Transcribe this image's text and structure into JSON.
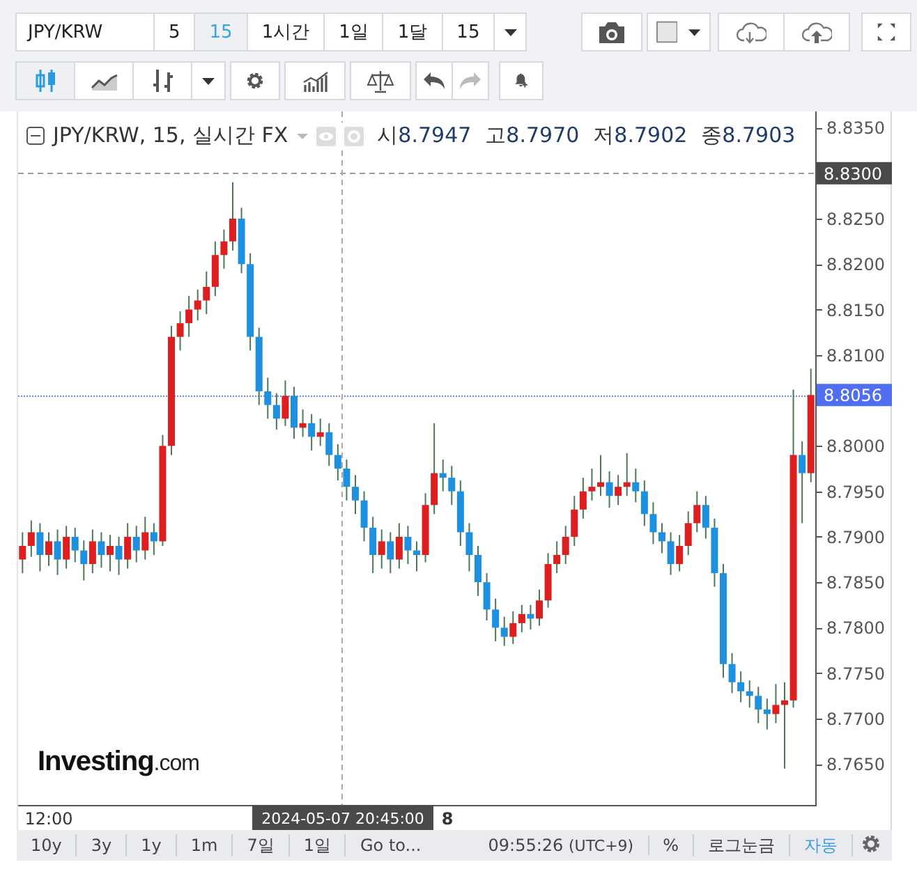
{
  "toolbar": {
    "symbol": "JPY/KRW",
    "intervals": [
      {
        "label": "5",
        "selected": false
      },
      {
        "label": "15",
        "selected": true
      },
      {
        "label": "1시간",
        "selected": false
      },
      {
        "label": "1일",
        "selected": false
      },
      {
        "label": "1달",
        "selected": false
      }
    ],
    "interval_dropdown": "15",
    "chart_types": [
      {
        "kind": "candle",
        "selected": true
      },
      {
        "kind": "area",
        "selected": false
      },
      {
        "kind": "bar",
        "selected": false
      }
    ]
  },
  "legend": {
    "title": "JPY/KRW, 15, 실시간 FX",
    "values": [
      {
        "label": "시",
        "value": "8.7947"
      },
      {
        "label": "고",
        "value": "8.7970"
      },
      {
        "label": "저",
        "value": "8.7902"
      },
      {
        "label": "종",
        "value": "8.7903"
      }
    ]
  },
  "chart": {
    "chart_data": {
      "type": "candlestick",
      "ylim": [
        8.7605,
        8.8368
      ],
      "ref_lines": [
        {
          "axis": "y",
          "value": 8.83,
          "label": "8.8300",
          "color": "#4a4a4a"
        },
        {
          "axis": "y",
          "value": 8.8056,
          "label": "8.8056",
          "color": "#4f6ff0"
        }
      ],
      "yticks": [
        {
          "value": 8.835,
          "label": "8.8350"
        },
        {
          "value": 8.825,
          "label": "8.8250"
        },
        {
          "value": 8.82,
          "label": "8.8200"
        },
        {
          "value": 8.815,
          "label": "8.8150"
        },
        {
          "value": 8.81,
          "label": "8.8100"
        },
        {
          "value": 8.8,
          "label": "8.8000"
        },
        {
          "value": 8.795,
          "label": "8.7950"
        },
        {
          "value": 8.79,
          "label": "8.7900"
        },
        {
          "value": 8.785,
          "label": "8.7850"
        },
        {
          "value": 8.78,
          "label": "8.7800"
        },
        {
          "value": 8.775,
          "label": "8.7750"
        },
        {
          "value": 8.77,
          "label": "8.7700"
        },
        {
          "value": 8.765,
          "label": "8.7650"
        }
      ],
      "categories": [
        null,
        null,
        null,
        null,
        null,
        null,
        null,
        null,
        null,
        null,
        null,
        null,
        null,
        null,
        null,
        null,
        null,
        null,
        null,
        null,
        null,
        null,
        null,
        null,
        null,
        null,
        null,
        null,
        null,
        null,
        null,
        null,
        null,
        null,
        null,
        null,
        null,
        null,
        null,
        null,
        null,
        null,
        null,
        null,
        null,
        null,
        null,
        null,
        null,
        null,
        null,
        null,
        null,
        null,
        null,
        null,
        null,
        null,
        null,
        null,
        null,
        null,
        null,
        null,
        null,
        null,
        null,
        null,
        null,
        null,
        null,
        null,
        null,
        null,
        null,
        null,
        null,
        null,
        null,
        null,
        null,
        null,
        null,
        null,
        null,
        null,
        null,
        null,
        null,
        null,
        null
      ],
      "ohlc": [
        [
          8.7875,
          8.7905,
          8.786,
          8.789
        ],
        [
          8.789,
          8.7918,
          8.7878,
          8.7905
        ],
        [
          8.7905,
          8.7915,
          8.7862,
          8.788
        ],
        [
          8.788,
          8.7905,
          8.7868,
          8.7895
        ],
        [
          8.7895,
          8.7908,
          8.7858,
          8.7875
        ],
        [
          8.7875,
          8.7912,
          8.7865,
          8.79
        ],
        [
          8.79,
          8.791,
          8.7872,
          8.7885
        ],
        [
          8.7885,
          8.7896,
          8.7852,
          8.787
        ],
        [
          8.787,
          8.7908,
          8.786,
          8.7895
        ],
        [
          8.7895,
          8.7905,
          8.7866,
          8.788
        ],
        [
          8.788,
          8.7902,
          8.7862,
          8.789
        ],
        [
          8.789,
          8.79,
          8.7858,
          8.7875
        ],
        [
          8.7875,
          8.7915,
          8.7865,
          8.79
        ],
        [
          8.79,
          8.7912,
          8.7872,
          8.7885
        ],
        [
          8.7885,
          8.7922,
          8.7875,
          8.7905
        ],
        [
          8.7905,
          8.7915,
          8.788,
          8.7895
        ],
        [
          8.7895,
          8.8012,
          8.789,
          8.8
        ],
        [
          8.8,
          8.8132,
          8.799,
          8.812
        ],
        [
          8.812,
          8.8148,
          8.8105,
          8.8135
        ],
        [
          8.8135,
          8.8165,
          8.812,
          8.815
        ],
        [
          8.815,
          8.8172,
          8.8138,
          8.816
        ],
        [
          8.816,
          8.8192,
          8.8145,
          8.8175
        ],
        [
          8.8175,
          8.8225,
          8.8165,
          8.821
        ],
        [
          8.821,
          8.8238,
          8.8195,
          8.8225
        ],
        [
          8.8225,
          8.829,
          8.8215,
          8.825
        ],
        [
          8.825,
          8.8262,
          8.819,
          8.82
        ],
        [
          8.82,
          8.8212,
          8.8105,
          8.812
        ],
        [
          8.812,
          8.813,
          8.8045,
          8.806
        ],
        [
          8.806,
          8.8075,
          8.803,
          8.8045
        ],
        [
          8.8045,
          8.8058,
          8.8018,
          8.803
        ],
        [
          8.803,
          8.8072,
          8.8022,
          8.8055
        ],
        [
          8.8055,
          8.8065,
          8.8008,
          8.802
        ],
        [
          8.802,
          8.804,
          8.801,
          8.8025
        ],
        [
          8.8025,
          8.8035,
          8.7995,
          8.801
        ],
        [
          8.801,
          8.803,
          8.8,
          8.8015
        ],
        [
          8.8015,
          8.8025,
          8.7978,
          8.799
        ],
        [
          8.799,
          8.8002,
          8.7962,
          8.7975
        ],
        [
          8.7975,
          8.7985,
          8.794,
          8.7955
        ],
        [
          8.7955,
          8.7968,
          8.7925,
          8.794
        ],
        [
          8.794,
          8.795,
          8.7895,
          8.791
        ],
        [
          8.791,
          8.7922,
          8.786,
          8.788
        ],
        [
          8.788,
          8.7908,
          8.7865,
          8.7895
        ],
        [
          8.7895,
          8.7905,
          8.786,
          8.7875
        ],
        [
          8.7875,
          8.7915,
          8.7865,
          8.79
        ],
        [
          8.79,
          8.7912,
          8.787,
          8.7885
        ],
        [
          8.7885,
          8.7895,
          8.7862,
          8.788
        ],
        [
          8.788,
          8.7948,
          8.7872,
          8.7935
        ],
        [
          8.7935,
          8.8025,
          8.7925,
          8.797
        ],
        [
          8.797,
          8.7985,
          8.795,
          8.7965
        ],
        [
          8.7965,
          8.7978,
          8.7935,
          8.795
        ],
        [
          8.795,
          8.7962,
          8.789,
          8.7905
        ],
        [
          8.7905,
          8.7915,
          8.7862,
          8.788
        ],
        [
          8.788,
          8.789,
          8.7835,
          8.785
        ],
        [
          8.785,
          8.786,
          8.7808,
          8.782
        ],
        [
          8.782,
          8.7832,
          8.7785,
          8.78
        ],
        [
          8.78,
          8.7812,
          8.778,
          8.779
        ],
        [
          8.779,
          8.7818,
          8.7782,
          8.7805
        ],
        [
          8.7805,
          8.7825,
          8.7795,
          8.7815
        ],
        [
          8.7815,
          8.7825,
          8.7798,
          8.781
        ],
        [
          8.781,
          8.7842,
          8.7802,
          8.783
        ],
        [
          8.783,
          8.7882,
          8.7822,
          8.787
        ],
        [
          8.787,
          8.7895,
          8.786,
          8.788
        ],
        [
          8.788,
          8.7912,
          8.787,
          8.79
        ],
        [
          8.79,
          8.7945,
          8.789,
          8.793
        ],
        [
          8.793,
          8.7965,
          8.792,
          8.795
        ],
        [
          8.795,
          8.7975,
          8.794,
          8.7955
        ],
        [
          8.7955,
          8.799,
          8.7945,
          8.796
        ],
        [
          8.796,
          8.7972,
          8.7932,
          8.7945
        ],
        [
          8.7945,
          8.7968,
          8.7935,
          8.7955
        ],
        [
          8.7955,
          8.7992,
          8.7945,
          8.796
        ],
        [
          8.796,
          8.7975,
          8.7938,
          8.795
        ],
        [
          8.795,
          8.7962,
          8.7912,
          8.7925
        ],
        [
          8.7925,
          8.7938,
          8.7892,
          8.7905
        ],
        [
          8.7905,
          8.7915,
          8.7882,
          8.7895
        ],
        [
          8.7895,
          8.7905,
          8.7858,
          8.787
        ],
        [
          8.787,
          8.7902,
          8.7862,
          8.789
        ],
        [
          8.789,
          8.7928,
          8.788,
          8.7915
        ],
        [
          8.7915,
          8.795,
          8.7905,
          8.7935
        ],
        [
          8.7935,
          8.7945,
          8.7898,
          8.791
        ],
        [
          8.791,
          8.792,
          8.7845,
          8.786
        ],
        [
          8.786,
          8.787,
          8.7745,
          8.776
        ],
        [
          8.776,
          8.7772,
          8.7728,
          8.774
        ],
        [
          8.774,
          8.7752,
          8.7718,
          8.773
        ],
        [
          8.773,
          8.7742,
          8.7712,
          8.7725
        ],
        [
          8.7725,
          8.7735,
          8.7695,
          8.771
        ],
        [
          8.771,
          8.7722,
          8.7688,
          8.7705
        ],
        [
          8.7705,
          8.7738,
          8.7695,
          8.7715
        ],
        [
          8.7715,
          8.774,
          8.7645,
          8.772
        ],
        [
          8.772,
          8.8062,
          8.7712,
          8.799
        ],
        [
          8.799,
          8.8005,
          8.7915,
          8.797
        ],
        [
          8.797,
          8.8085,
          8.796,
          8.8056
        ]
      ]
    }
  },
  "time_axis": {
    "labels": [
      {
        "text": "12:00",
        "kind": "time"
      },
      {
        "text": "8",
        "kind": "day"
      }
    ],
    "crosshair_time": "2024-05-07 20:45:00"
  },
  "logo": {
    "brand": "Investing",
    "suffix": ".com"
  },
  "bottom_bar": {
    "ranges": [
      "10y",
      "3y",
      "1y",
      "1m",
      "7일",
      "1일",
      "Go to..."
    ],
    "clock": "09:55:26",
    "timezone": "(UTC+9)",
    "options": [
      {
        "label": "%",
        "selected": false
      },
      {
        "label": "로그눈금",
        "selected": false
      },
      {
        "label": "자동",
        "selected": true
      }
    ]
  }
}
